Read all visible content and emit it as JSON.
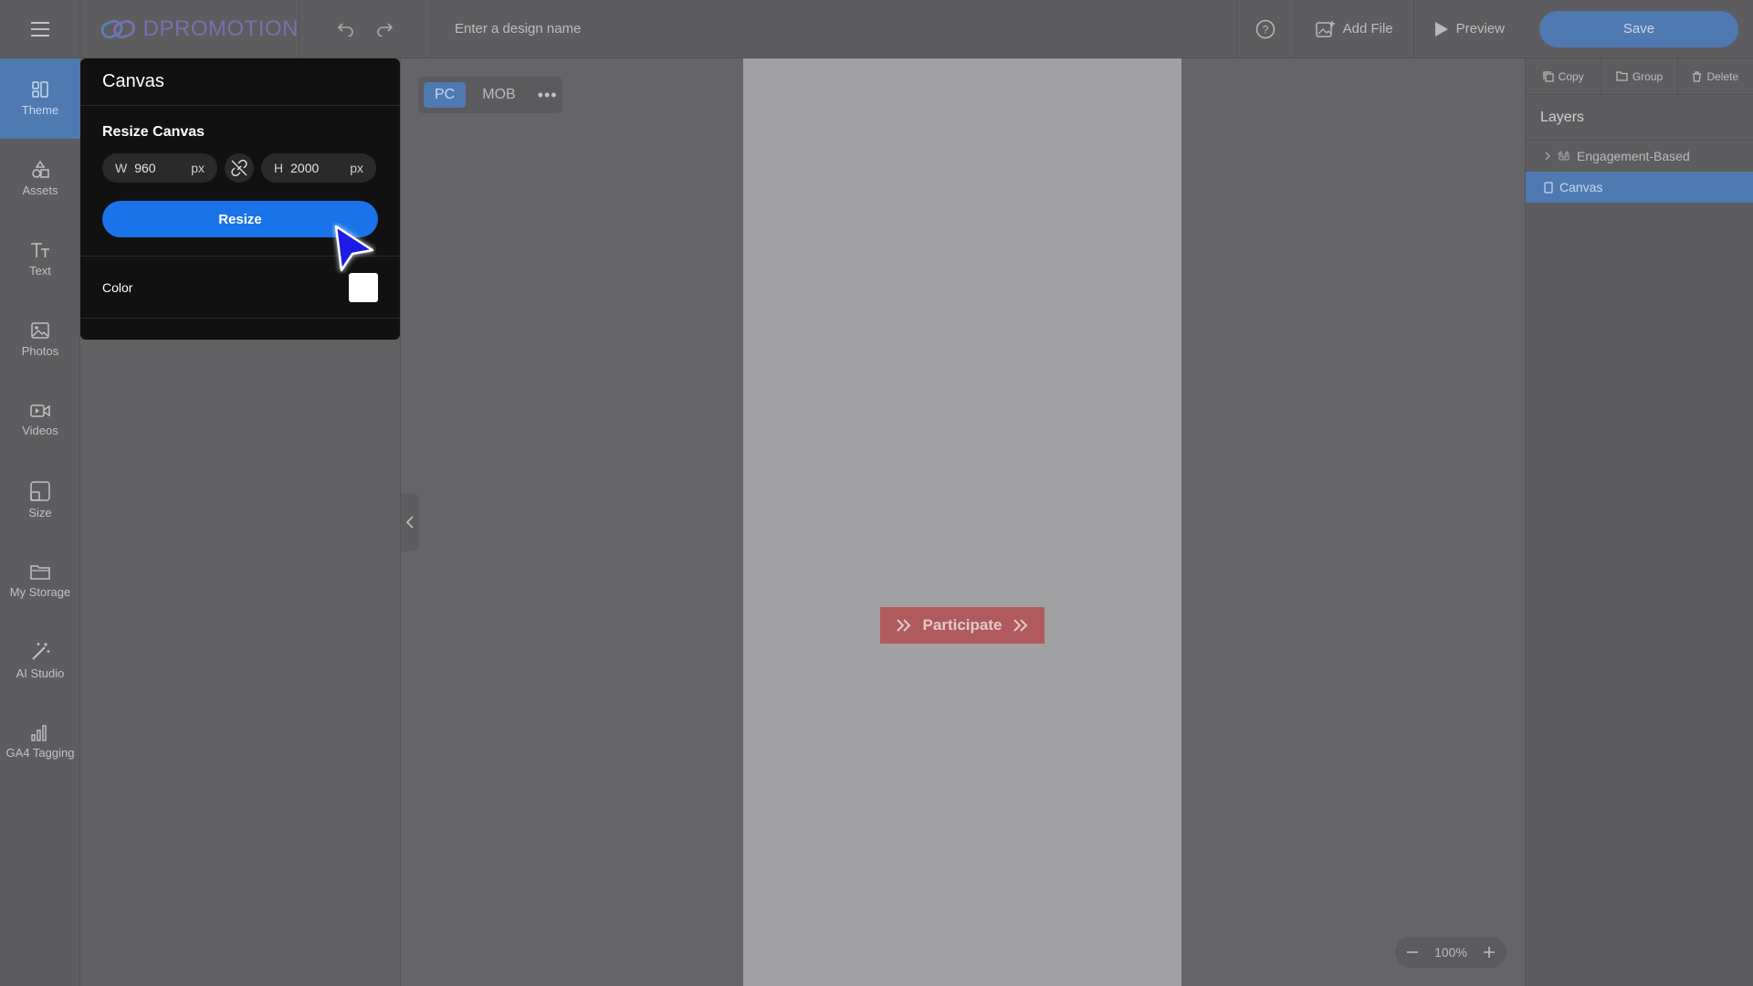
{
  "app": {
    "logo_text": "DPROMOTION",
    "design_name_placeholder": "Enter a design name"
  },
  "toolbar": {
    "add_file": "Add File",
    "preview": "Preview",
    "save": "Save"
  },
  "sidebar": {
    "items": [
      {
        "label": "Theme",
        "icon": "theme-icon"
      },
      {
        "label": "Assets",
        "icon": "shapes-icon"
      },
      {
        "label": "Text",
        "icon": "text-icon"
      },
      {
        "label": "Photos",
        "icon": "image-icon"
      },
      {
        "label": "Videos",
        "icon": "video-icon"
      },
      {
        "label": "Size",
        "icon": "resize-icon"
      },
      {
        "label": "My Storage",
        "icon": "folder-icon"
      },
      {
        "label": "AI Studio",
        "icon": "magic-wand-icon"
      },
      {
        "label": "GA4 Tagging",
        "icon": "bar-chart-icon"
      }
    ]
  },
  "canvas_panel": {
    "title": "Canvas",
    "resize_heading": "Resize Canvas",
    "width_label": "W",
    "width_value": "960",
    "height_label": "H",
    "height_value": "2000",
    "unit": "px",
    "resize_button": "Resize",
    "color_label": "Color",
    "color_value": "#ffffff"
  },
  "device": {
    "pc": "PC",
    "mob": "MOB",
    "more": "•••"
  },
  "artboard": {
    "button_text": "Participate",
    "button_color": "#b05a5c"
  },
  "zoom": {
    "level": "100%"
  },
  "right_panel": {
    "copy": "Copy",
    "group": "Group",
    "delete": "Delete",
    "layers_title": "Layers",
    "layers": [
      {
        "name": "Engagement-Based"
      },
      {
        "name": "Canvas"
      }
    ]
  },
  "colors": {
    "accent": "#4f79b1",
    "primary_button": "#1a73e8",
    "logo": "#7d6dad"
  }
}
